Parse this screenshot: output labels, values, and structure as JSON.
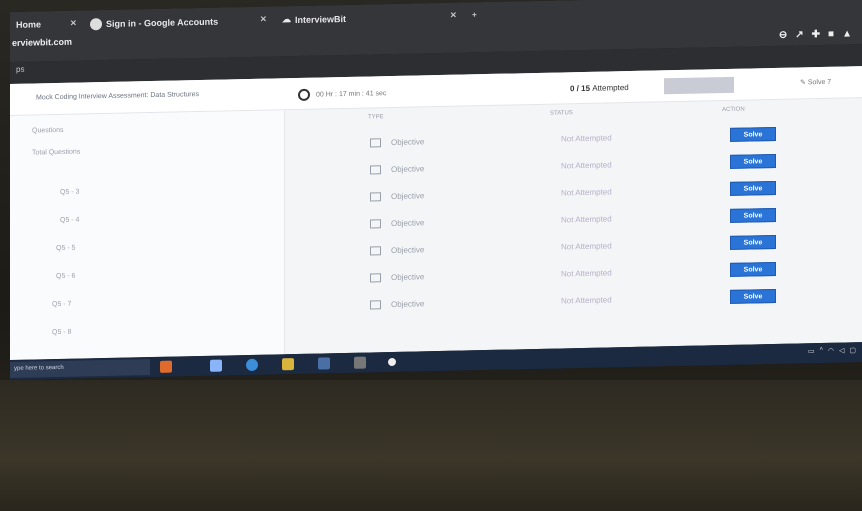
{
  "browser": {
    "tabs": [
      {
        "label": "Home"
      },
      {
        "label": "Sign in - Google Accounts"
      },
      {
        "label": "InterviewBit"
      }
    ],
    "url": "erviewbit.com",
    "address": "ps"
  },
  "header": {
    "test_title": "Mock Coding Interview Assessment: Data Structures",
    "timer": "00 Hr : 17 min : 41 sec",
    "attempted_count": "0 / 15",
    "attempted_label": "Attempted",
    "help": "Solve 7"
  },
  "sidebar": {
    "section_title": "Questions",
    "items": [
      "Total Questions",
      "Q5 - 3",
      "Q5 - 4",
      "Q5 - 5",
      "Q5 - 6",
      "Q5 - 7",
      "Q5 - 8"
    ]
  },
  "table": {
    "headers": {
      "type": "TYPE",
      "status": "STATUS",
      "action": "ACTION"
    },
    "rows": [
      {
        "type": "Objective",
        "status": "Not Attempted",
        "action": "Solve"
      },
      {
        "type": "Objective",
        "status": "Not Attempted",
        "action": "Solve"
      },
      {
        "type": "Objective",
        "status": "Not Attempted",
        "action": "Solve"
      },
      {
        "type": "Objective",
        "status": "Not Attempted",
        "action": "Solve"
      },
      {
        "type": "Objective",
        "status": "Not Attempted",
        "action": "Solve"
      },
      {
        "type": "Objective",
        "status": "Not Attempted",
        "action": "Solve"
      },
      {
        "type": "Objective",
        "status": "Not Attempted",
        "action": "Solve"
      }
    ]
  },
  "taskbar": {
    "search_placeholder": "ype here to search"
  },
  "colors": {
    "accent": "#2a74d8",
    "page_bg": "#f4f5f7",
    "browser_bg": "#35363a",
    "taskbar_bg": "#1b2a40"
  }
}
